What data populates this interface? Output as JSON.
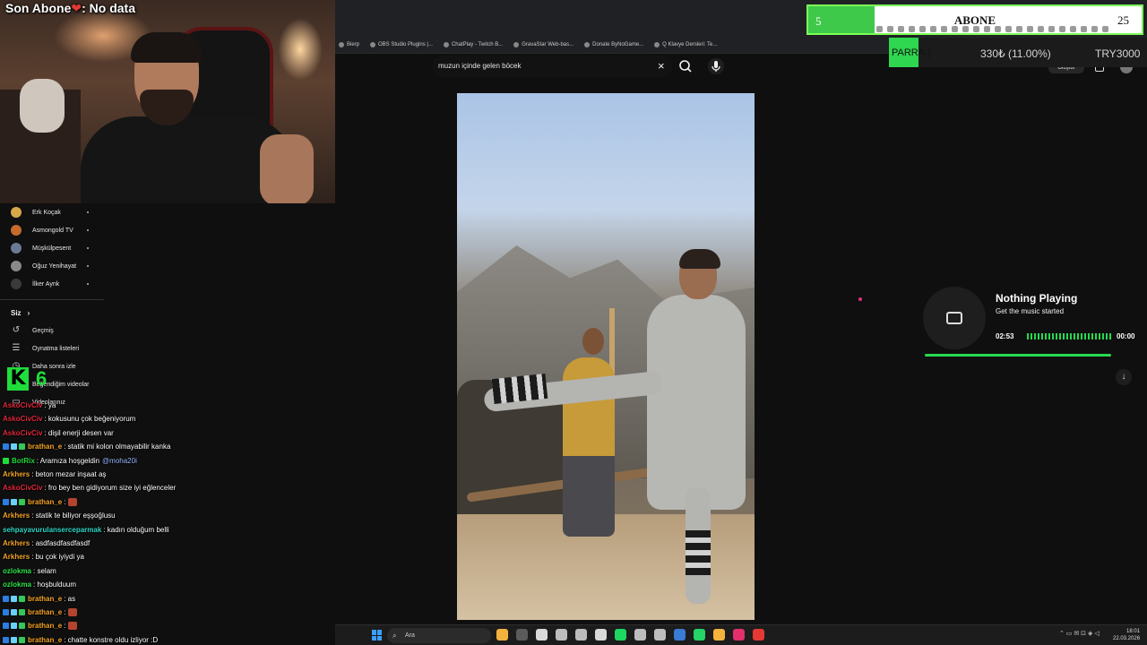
{
  "overlay": {
    "last_sub_label": "Son Abone",
    "last_sub_heart": "❤",
    "last_sub_value": ": No data"
  },
  "sub_goal": {
    "current": "5",
    "title": "ABONE",
    "target": "25",
    "progress_fraction": 0.2,
    "fill_color": "#3fc94a"
  },
  "ticker": {
    "label": "PARRA:)",
    "change": "330₺ (11.00%)",
    "price": "TRY3000"
  },
  "bookmarks": [
    {
      "label": "Bierp",
      "icon": "bookmark-icon"
    },
    {
      "label": "OBS Studio Plugins |...",
      "icon": "obs-icon"
    },
    {
      "label": "ChatPlay - Twitch B...",
      "icon": "twitch-icon"
    },
    {
      "label": "GravaStar Web-bas...",
      "icon": "gravastar-icon"
    },
    {
      "label": "Donate ByNoGame...",
      "icon": "donate-icon"
    },
    {
      "label": "Q Klavye Dersleri: Te...",
      "icon": "keyboard-icon"
    }
  ],
  "youtube": {
    "search_value": "muzun içinde gelen böcek",
    "clear_icon": "×",
    "header_button": "Oluştur"
  },
  "sidebar": {
    "subscriptions": [
      {
        "label": "Erk Koçak",
        "color": "#d6a84a"
      },
      {
        "label": "Asmongold TV",
        "color": "#c66b2c"
      },
      {
        "label": "Müşkülpesent",
        "color": "#6a7a96"
      },
      {
        "label": "Oğuz Yenihayat",
        "color": "#8a8a8a"
      },
      {
        "label": "İlker Aynk",
        "color": "#3a3a3a"
      }
    ],
    "you_section": "Siz",
    "you_chevron": "›",
    "you_items": [
      {
        "label": "Geçmiş",
        "icon": "history-icon",
        "glyph": "↺"
      },
      {
        "label": "Oynatma listeleri",
        "icon": "playlists-icon",
        "glyph": "☰"
      },
      {
        "label": "Daha sonra izle",
        "icon": "watch-later-icon",
        "glyph": "◷"
      },
      {
        "label": "Beğendiğim videolar",
        "icon": "like-icon",
        "glyph": "👍"
      },
      {
        "label": "Videolarınız",
        "icon": "your-videos-icon",
        "glyph": "▭"
      }
    ]
  },
  "kick": {
    "logo": "K",
    "count": "6",
    "color": "#1fdc3b"
  },
  "chat": [
    {
      "user": "AskoCivCiv",
      "color": "#e0283c",
      "text": ": ya",
      "badges": []
    },
    {
      "user": "AskoCivCiv",
      "color": "#e0283c",
      "text": ": kokusunu çok beğeniyorum",
      "badges": []
    },
    {
      "user": "AskoCivCiv",
      "color": "#e0283c",
      "text": ": dişil enerji desen var",
      "badges": []
    },
    {
      "user": "brathan_e",
      "color": "#f4a428",
      "text": ": statik mi kolon olmayabilir kanka",
      "badges": [
        "#2a7de1",
        "#6ad1ff",
        "#34c759"
      ]
    },
    {
      "user": "BotRix",
      "color": "#1fdc3b",
      "text": ": Aramıza hoşgeldin",
      "mention": "@moha20i",
      "badges": [
        "#1fdc3b"
      ]
    },
    {
      "user": "Arkhers",
      "color": "#f4a428",
      "text": ": beton mezar inşaat aş",
      "badges": []
    },
    {
      "user": "AskoCivCiv",
      "color": "#e0283c",
      "text": ": fro bey ben gidiyorum size iyi eğlenceler",
      "badges": []
    },
    {
      "user": "brathan_e",
      "color": "#f4a428",
      "text": ": ",
      "emote": true,
      "badges": [
        "#2a7de1",
        "#6ad1ff",
        "#34c759"
      ]
    },
    {
      "user": "Arkhers",
      "color": "#f4a428",
      "text": ": statik te biliyor eşşoğlusu",
      "badges": []
    },
    {
      "user": "sehpayavurulanserceparmak",
      "color": "#2fd8c8",
      "text": ": kadın olduğum belli",
      "badges": []
    },
    {
      "user": "Arkhers",
      "color": "#f4a428",
      "text": ": asdfasdfasdfasdf",
      "badges": []
    },
    {
      "user": "Arkhers",
      "color": "#f4a428",
      "text": ": bu çok iyiydi ya",
      "badges": []
    },
    {
      "user": "ozlokma",
      "color": "#2fe64b",
      "text": ": selam",
      "badges": []
    },
    {
      "user": "ozlokma",
      "color": "#2fe64b",
      "text": ": hoşbulduum",
      "badges": []
    },
    {
      "user": "brathan_e",
      "color": "#f4a428",
      "text": ": as",
      "badges": [
        "#2a7de1",
        "#6ad1ff",
        "#34c759"
      ]
    },
    {
      "user": "brathan_e",
      "color": "#f4a428",
      "text": ": ",
      "emote": true,
      "badges": [
        "#2a7de1",
        "#6ad1ff",
        "#34c759"
      ]
    },
    {
      "user": "brathan_e",
      "color": "#f4a428",
      "text": ": ",
      "emote": true,
      "badges": [
        "#2a7de1",
        "#6ad1ff",
        "#34c759"
      ]
    },
    {
      "user": "brathan_e",
      "color": "#f4a428",
      "text": ": chatte konstre oldu izliyor :D",
      "badges": [
        "#2a7de1",
        "#6ad1ff",
        "#34c759"
      ]
    }
  ],
  "music": {
    "title": "Nothing Playing",
    "subtitle": "Get the music started",
    "elapsed": "02:53",
    "remaining": "00:00",
    "progress_fraction": 0.999,
    "accent": "#27d94f",
    "scroll_icon": "↓"
  },
  "taskbar": {
    "search_placeholder": "Ara",
    "search_icon": "⌕",
    "apps": [
      "#f2b33d",
      "#5b5b5b",
      "#d9d9d9",
      "#bdbdbd",
      "#bdbdbd",
      "#d9d9d9",
      "#1ed760",
      "#bdbdbd",
      "#bdbdbd",
      "#3a7bd5",
      "#25d366",
      "#f2b33d",
      "#e1306c",
      "#e53935"
    ],
    "tray": "⌃ ▭ ✉ ⊡ ◈ ◁",
    "time": "18:01",
    "date": "22.03.2026"
  }
}
